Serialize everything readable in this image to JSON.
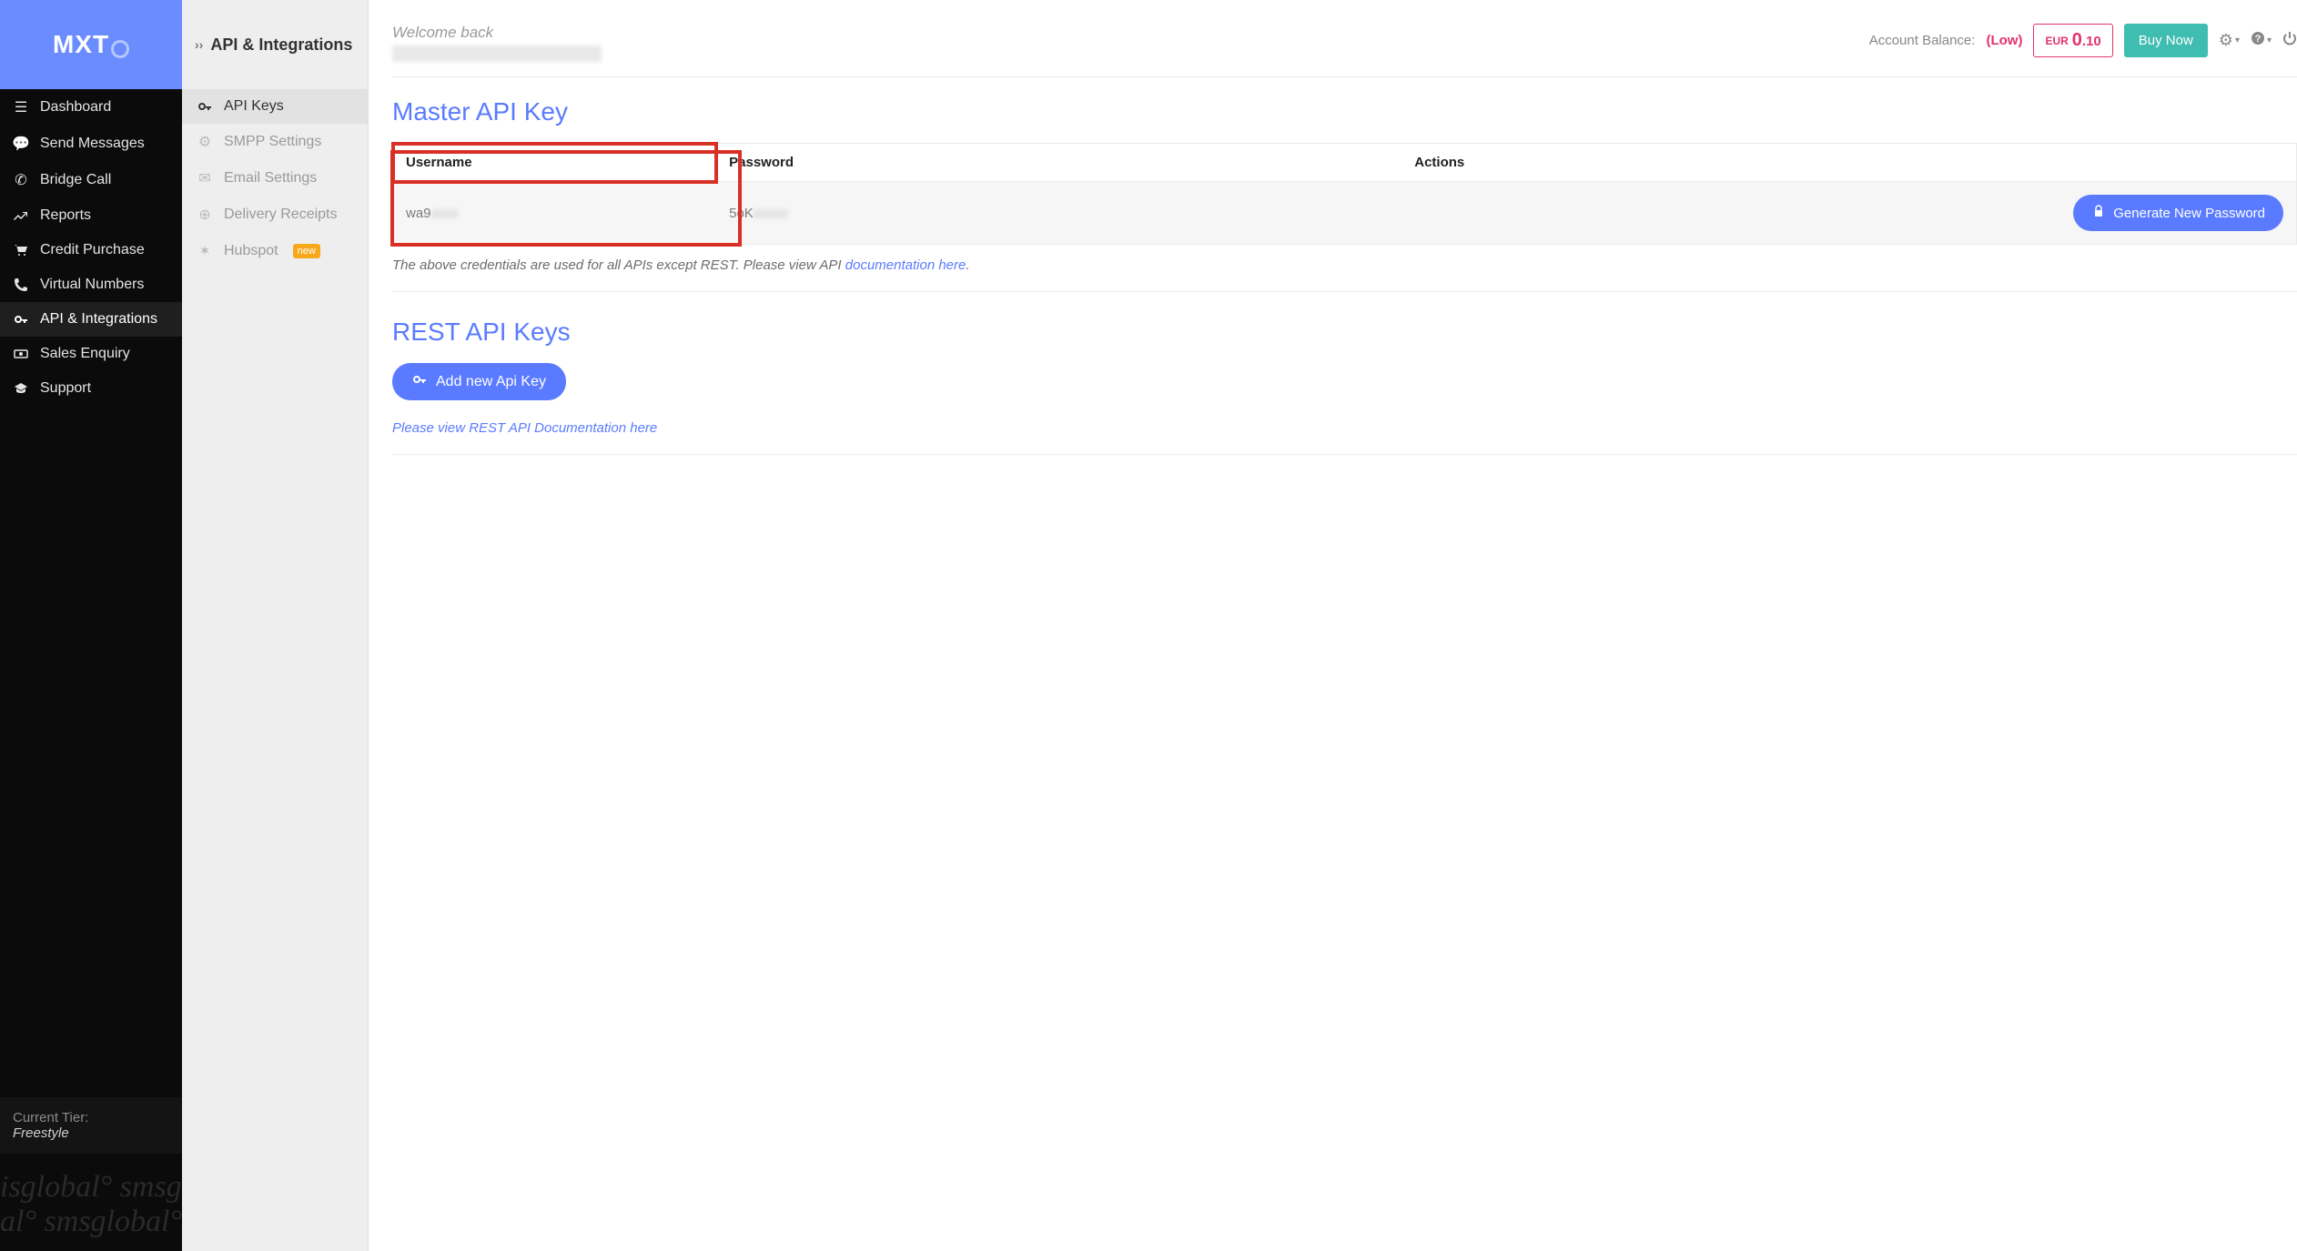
{
  "logo": "MXT",
  "primary_nav": {
    "dashboard": "Dashboard",
    "send_messages": "Send Messages",
    "bridge_call": "Bridge Call",
    "reports": "Reports",
    "credit_purchase": "Credit Purchase",
    "virtual_numbers": "Virtual Numbers",
    "api_integrations": "API & Integrations",
    "sales_enquiry": "Sales Enquiry",
    "support": "Support"
  },
  "tier": {
    "label": "Current Tier:",
    "value": "Freestyle"
  },
  "watermark": {
    "line1": "isglobal° smsglob",
    "line2": "al° smsglobal° sn"
  },
  "sub_header": "API & Integrations",
  "sub_nav": {
    "api_keys": "API Keys",
    "smpp_settings": "SMPP Settings",
    "email_settings": "Email Settings",
    "delivery_receipts": "Delivery Receipts",
    "hubspot": "Hubspot",
    "hubspot_badge": "new"
  },
  "topbar": {
    "welcome": "Welcome back",
    "account_balance_label": "Account Balance:",
    "low_label": "(Low)",
    "currency": "EUR",
    "amount_big": "0",
    "amount_small": ".10",
    "buy_now": "Buy Now"
  },
  "master": {
    "title": "Master API Key",
    "col_username": "Username",
    "col_password": "Password",
    "col_actions": "Actions",
    "username": "wa9",
    "password": "5oK",
    "generate_btn": "Generate New Password",
    "note_prefix": "The above credentials are used for all APIs except REST. Please view API ",
    "note_link": "documentation here",
    "note_suffix": "."
  },
  "rest": {
    "title": "REST API Keys",
    "add_btn": "Add new Api Key",
    "doc_link": "Please view REST API Documentation here"
  }
}
